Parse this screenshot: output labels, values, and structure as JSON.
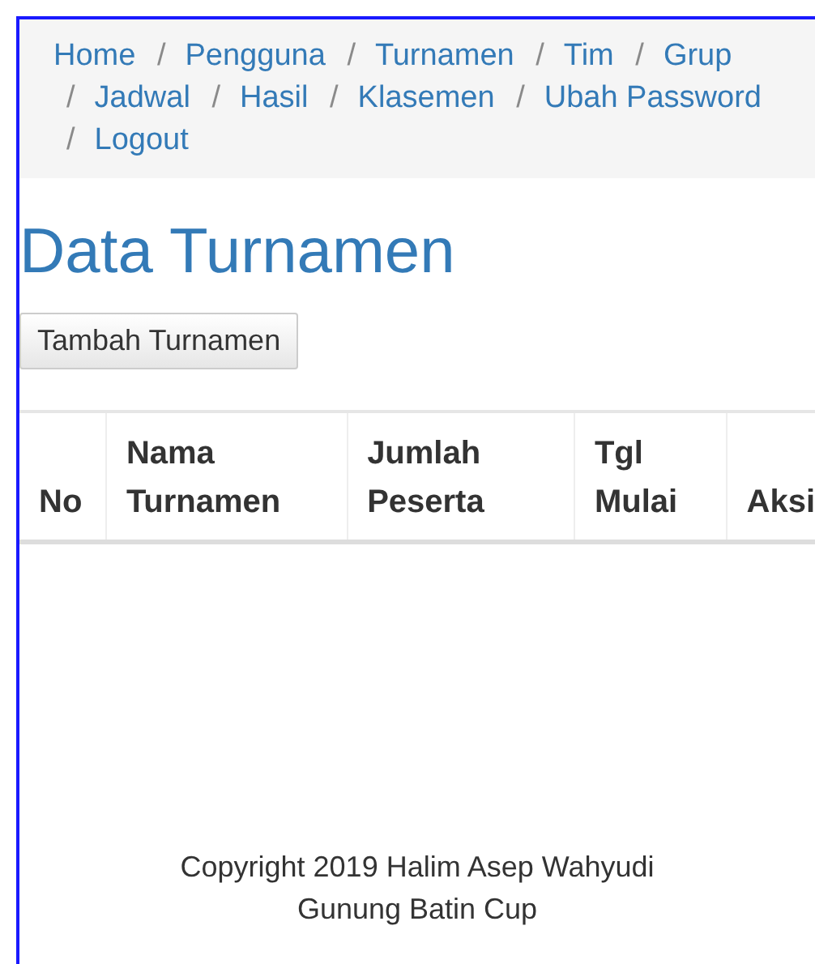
{
  "breadcrumb": [
    {
      "label": "Home"
    },
    {
      "label": "Pengguna",
      "separator": "/"
    },
    {
      "label": "Turnamen",
      "separator": "/"
    },
    {
      "label": "Tim",
      "separator": "/"
    },
    {
      "label": "Grup",
      "separator": "/"
    },
    {
      "label": "Jadwal",
      "separator": "/"
    },
    {
      "label": "Hasil",
      "separator": "/"
    },
    {
      "label": "Klasemen",
      "separator": "/"
    },
    {
      "label": "Ubah Password",
      "separator": "/"
    },
    {
      "label": "Logout",
      "separator": "/"
    }
  ],
  "page_title": "Data Turnamen",
  "add_button": "Tambah Turnamen",
  "table": {
    "columns": [
      "No",
      "Nama Turnamen",
      "Jumlah Peserta",
      "Tgl Mulai",
      "Aksi"
    ]
  },
  "footer": [
    "Copyright 2019 Halim Asep Wahyudi",
    "Gunung Batin Cup"
  ]
}
